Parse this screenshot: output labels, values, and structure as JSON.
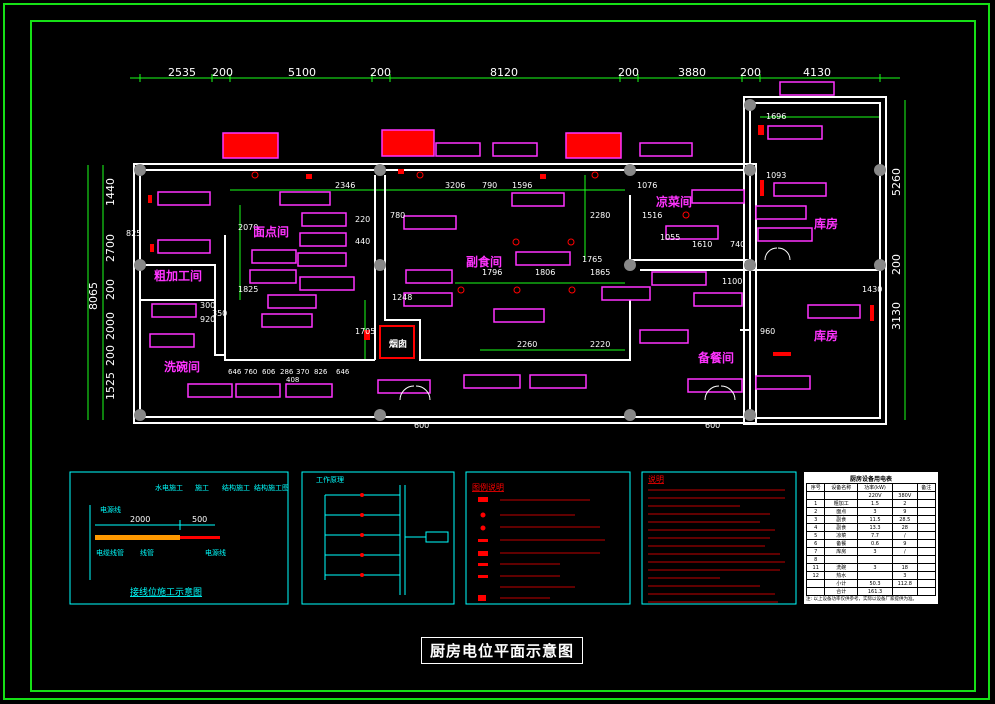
{
  "title": "厨房电位平面示意图",
  "colors": {
    "frame": "#16e016",
    "wall": "#ffffff",
    "dim": "#1aff1a",
    "room_label": "#ff33ff",
    "equipment": "#ff0000",
    "panel_border": "#00ffff"
  },
  "top_dims": [
    "2535",
    "200",
    "5100",
    "200",
    "8120",
    "200",
    "3880",
    "200",
    "4130"
  ],
  "left_dims": [
    "1440",
    "2700",
    "200",
    "2000",
    "200",
    "1525"
  ],
  "left_total": "8065",
  "right_dims": [
    "5260",
    "200",
    "3130"
  ],
  "interior_dims": [
    "2346",
    "3206",
    "790",
    "1596",
    "1076",
    "1696",
    "1516",
    "1610",
    "740",
    "1796",
    "1806",
    "1865",
    "1100",
    "2260",
    "2220",
    "960",
    "2280",
    "1765",
    "1705",
    "1248",
    "2070",
    "1825",
    "1430",
    "1093",
    "1055",
    "440",
    "825",
    "300",
    "220",
    "780",
    "920",
    "350"
  ],
  "bottom_dims": [
    "646",
    "760",
    "606",
    "286",
    "370",
    "826",
    "646",
    "408"
  ],
  "door_dims": [
    "600",
    "600"
  ],
  "rooms": [
    "面点间",
    "粗加工间",
    "洗碗间",
    "烟囱",
    "副食间",
    "凉菜间",
    "库房",
    "库房",
    "备餐间"
  ],
  "panel1": {
    "labels": [
      "水电施工",
      "施工",
      "结构施工",
      "结构施工图"
    ],
    "dim_a": "2000",
    "dim_b": "500",
    "caption": "接线位施工示意图",
    "notes": [
      "电源线",
      "电缆线管",
      "线管",
      "电源线"
    ]
  },
  "panel2": {
    "heading": "工作原理"
  },
  "panel3": {
    "heading": "图例说明"
  },
  "panel4": {
    "heading": "说明"
  },
  "panel5": {
    "heading": "厨房设备用电表",
    "columns": [
      "序号",
      "设备名称",
      "功率(kW)",
      "",
      "备注"
    ],
    "subcolumns": [
      "220V",
      "380V"
    ],
    "rows": [
      [
        "1",
        "粗加工",
        "1.5",
        "2",
        ""
      ],
      [
        "2",
        "面点",
        "3",
        "9",
        ""
      ],
      [
        "3",
        "副食",
        "11.5",
        "28.5",
        ""
      ],
      [
        "4",
        "副食",
        "13.3",
        "28",
        ""
      ],
      [
        "5",
        "凉菜",
        "7.7",
        "/",
        ""
      ],
      [
        "6",
        "备餐",
        "0.6",
        "9",
        ""
      ],
      [
        "7",
        "库房",
        "3",
        "/",
        ""
      ],
      [
        "8",
        "",
        "",
        "",
        ""
      ],
      [
        "11",
        "洗碗",
        "3",
        "18",
        ""
      ],
      [
        "12",
        "热水",
        "",
        "3",
        ""
      ],
      [
        "",
        "小计",
        "50.3",
        "112.8",
        ""
      ],
      [
        "",
        "合计",
        "161.3",
        "",
        ""
      ]
    ],
    "footnote": "注: 以上设备功率仅供参考，实际以设备厂家提供为准。"
  }
}
